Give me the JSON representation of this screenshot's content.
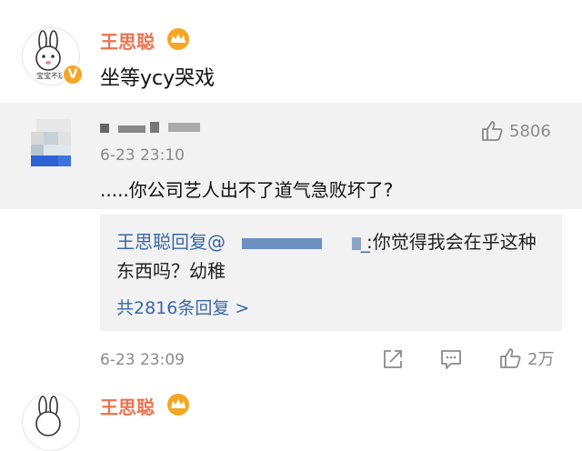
{
  "post": {
    "username": "王思聪",
    "badge": "♛",
    "text": "坐等ycy哭戏",
    "avatar_label": "宝宝不玩",
    "meta": {
      "time": "6-23 23:09",
      "like_count": "2万"
    }
  },
  "hot_comment": {
    "username_censored": "",
    "time": "6-23 23:10",
    "like_count": "5806",
    "text": ".....你公司艺人出不了道气急败坏了?"
  },
  "reply": {
    "author": "王思聪",
    "action": "回复@",
    "mention_suffix": "_",
    "text": ":你觉得我会在乎这种东西吗？幼稚",
    "more_replies": "共2816条回复 >"
  },
  "next_post": {
    "username": "王思聪",
    "badge": "♛"
  },
  "colors": {
    "username": "#eb7350",
    "link": "#3a67a7",
    "badge": "#f5a623",
    "gray_text": "#8a8a8a",
    "reply_bg": "#f2f2f2"
  },
  "icons": [
    "crown-badge-icon",
    "thumbs-up-icon",
    "share-icon",
    "comment-icon"
  ]
}
